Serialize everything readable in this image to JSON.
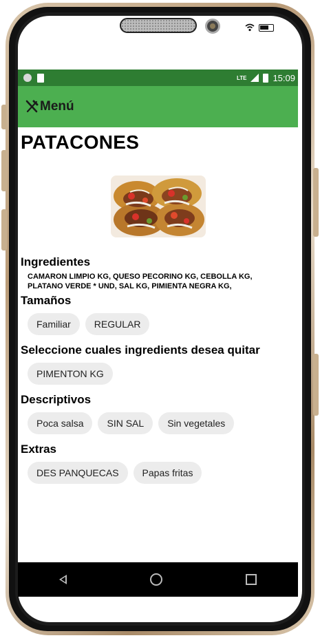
{
  "device": {
    "status_time": "15:09",
    "network_label": "LTE"
  },
  "toolbar": {
    "title": "Menú",
    "icon": "fork-knife-icon"
  },
  "dish": {
    "name": "PATACONES",
    "image_icon": "food-photo"
  },
  "sections": {
    "ingredients_title": "Ingredientes",
    "ingredients_text": "CAMARON LIMPIO KG, QUESO PECORINO KG, CEBOLLA KG, PLATANO VERDE * UND, SAL KG, PIMIENTA NEGRA KG,",
    "sizes_title": "Tamaños",
    "sizes": [
      "Familiar",
      "REGULAR"
    ],
    "remove_title": "Seleccione cuales ingredients desea quitar",
    "remove": [
      "PIMENTON KG"
    ],
    "descriptive_title": "Descriptivos",
    "descriptive": [
      "Poca salsa",
      "SIN SAL",
      "Sin vegetales"
    ],
    "extras_title": "Extras",
    "extras": [
      "DES PANQUECAS",
      "Papas fritas"
    ]
  },
  "colors": {
    "toolbar": "#4caf50",
    "statusbar": "#2e7d32",
    "chip": "#ececec"
  }
}
